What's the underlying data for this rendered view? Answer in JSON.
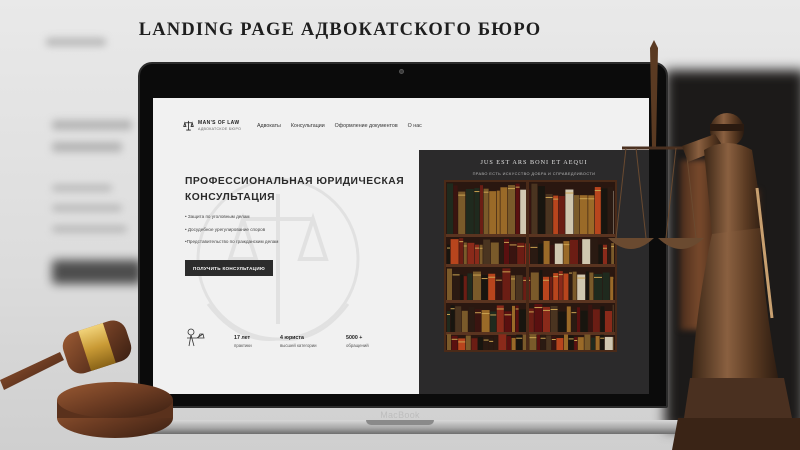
{
  "headline": "LANDING PAGE АДВОКАТСКОГО БЮРО",
  "laptop": {
    "brand": "MacBook"
  },
  "site": {
    "logo": {
      "name": "MAN'S OF LAW",
      "tagline": "АДВОКАТСКОЕ БЮРО",
      "icon": "scales-icon"
    },
    "nav": [
      {
        "label": "Адвокаты"
      },
      {
        "label": "Консультации"
      },
      {
        "label": "Оформление документов"
      },
      {
        "label": "О нас"
      }
    ],
    "hero": {
      "title_line1": "ПРОФЕССИОНАЛЬНАЯ ЮРИДИЧЕСКАЯ",
      "title_line2": "КОНСУЛЬТАЦИЯ",
      "bullets": [
        "• Защита по уголовным делам",
        "• Досудебное урегулирование споров",
        "•Представительство по гражданским делам"
      ],
      "cta_label": "ПОЛУЧИТЬ КОНСУЛЬТАЦИЮ"
    },
    "stats": [
      {
        "value": "17 лет",
        "label_line1": "практики",
        "label_line2": ""
      },
      {
        "value": "4 юриста",
        "label_line1": "высшей категории",
        "label_line2": ""
      },
      {
        "value": "5000 +",
        "label_line1": "обращений",
        "label_line2": ""
      }
    ],
    "panel": {
      "motto": "JUS EST ARS BONI ET AEQUI",
      "motto_translation": "ПРАВО ЕСТЬ ИСКУССТВО ДОБРА И СПРАВЕДЛИВОСТИ"
    }
  },
  "colors": {
    "page_bg": "#f1f1f1",
    "dark_panel": "#2b2a2b",
    "button": "#2c2c2c",
    "wood": "#6b3b22",
    "bronze": "#7a5433"
  }
}
